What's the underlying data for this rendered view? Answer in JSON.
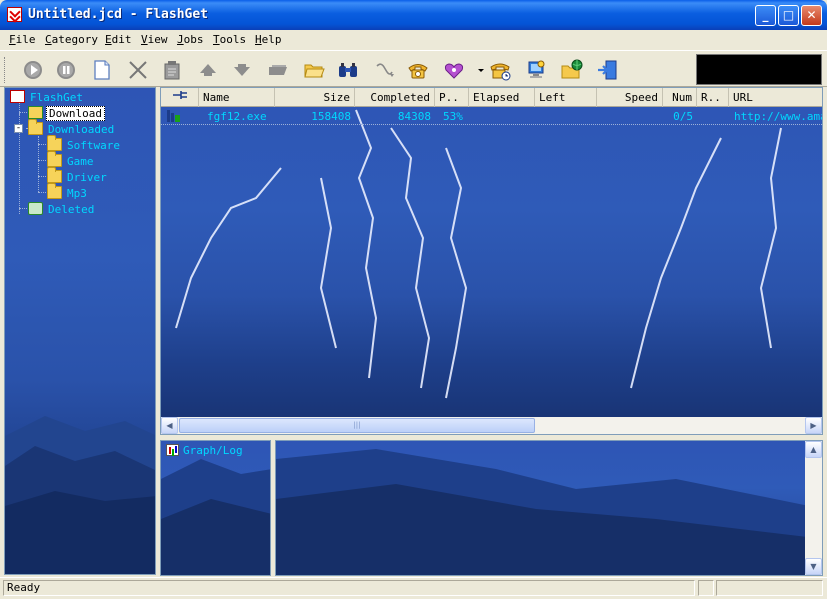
{
  "window": {
    "title": "Untitled.jcd - FlashGet",
    "minimize_glyph": "_",
    "maximize_glyph": "□",
    "close_glyph": "✕"
  },
  "menu": [
    "File",
    "Category",
    "Edit",
    "View",
    "Jobs",
    "Tools",
    "Help"
  ],
  "toolbar": {
    "icons": [
      "start-icon",
      "pause-icon",
      "new-job-icon",
      "delete-icon",
      "properties-icon",
      "move-up-icon",
      "move-down-icon",
      "open-folder-icon",
      "open-icon",
      "find-icon",
      "dial-icon",
      "phone-icon",
      "speed-icon",
      "dropdown-icon",
      "schedule-icon",
      "site-explorer-icon",
      "web-icon",
      "exit-icon"
    ]
  },
  "tree": {
    "root": "FlashGet",
    "items": [
      {
        "label": "Download",
        "level": 1,
        "selected": true
      },
      {
        "label": "Downloaded",
        "level": 1,
        "expanded": true
      },
      {
        "label": "Software",
        "level": 2
      },
      {
        "label": "Game",
        "level": 2
      },
      {
        "label": "Driver",
        "level": 2
      },
      {
        "label": "Mp3",
        "level": 2
      },
      {
        "label": "Deleted",
        "level": 1
      }
    ]
  },
  "list": {
    "columns": [
      "Name",
      "Size",
      "Completed",
      "P..",
      "Elapsed",
      "Left",
      "Speed",
      "Num",
      "R..",
      "URL"
    ],
    "rows": [
      {
        "name": "fgf12.exe",
        "size": "158408",
        "completed": "84308",
        "percent": "53%",
        "elapsed": "",
        "left": "",
        "speed": "",
        "num": "0/5",
        "r": "",
        "url": "http://www.amaz"
      }
    ]
  },
  "scrollbars": {
    "left_arrow": "◀",
    "right_arrow": "▶",
    "up_arrow": "▲",
    "down_arrow": "▼",
    "grip": "|||"
  },
  "graph": {
    "title": "Graph/Log"
  },
  "status": {
    "text": "Ready"
  }
}
